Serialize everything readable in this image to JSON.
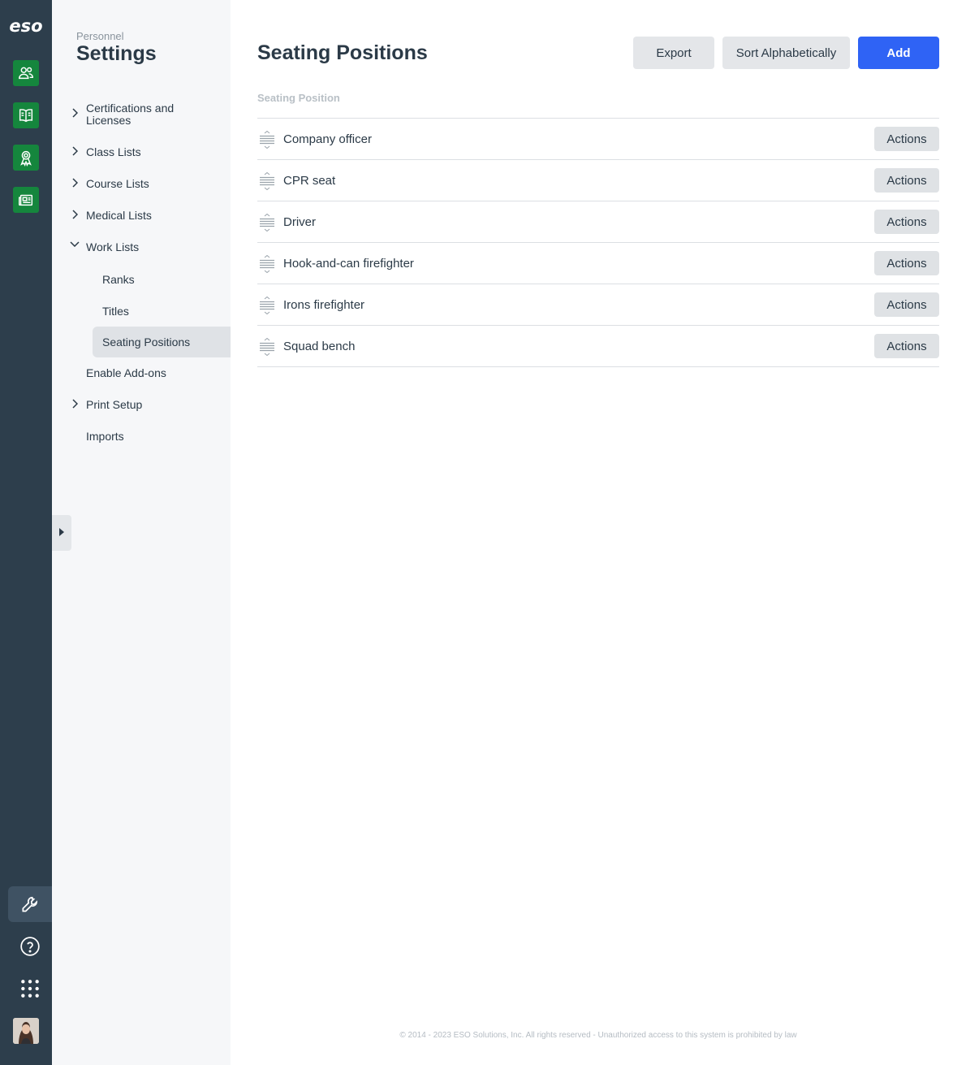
{
  "rail": {
    "logo": "eso",
    "apps": [
      {
        "icon": "people-icon"
      },
      {
        "icon": "book-icon"
      },
      {
        "icon": "award-ribbon-icon"
      },
      {
        "icon": "news-id-icon"
      }
    ],
    "bottom": [
      {
        "icon": "wrench-icon",
        "active": true
      },
      {
        "icon": "help-circle-icon"
      },
      {
        "icon": "app-grid-icon"
      }
    ],
    "accent_color": "#15863d",
    "rail_color": "#2d3e4c"
  },
  "nav": {
    "eyebrow": "Personnel",
    "title": "Settings",
    "items": [
      {
        "label_line1": "Certifications and",
        "label_line2": "Licenses",
        "chevron": "right"
      },
      {
        "label": "Class Lists",
        "chevron": "right"
      },
      {
        "label": "Course Lists",
        "chevron": "right"
      },
      {
        "label": "Medical Lists",
        "chevron": "right"
      },
      {
        "label": "Work Lists",
        "chevron": "down"
      },
      {
        "label": "Enable Add-ons"
      },
      {
        "label": "Print Setup",
        "chevron": "right"
      },
      {
        "label": "Imports"
      }
    ],
    "work_lists_children": [
      {
        "label": "Ranks"
      },
      {
        "label": "Titles"
      },
      {
        "label": "Seating Positions",
        "active": true
      }
    ]
  },
  "main": {
    "title": "Seating Positions",
    "buttons": {
      "export": "Export",
      "sort": "Sort Alphabetically",
      "add": "Add"
    },
    "column_header": "Seating Position",
    "rows": [
      {
        "label": "Company officer",
        "action": "Actions"
      },
      {
        "label": "CPR seat",
        "action": "Actions"
      },
      {
        "label": "Driver",
        "action": "Actions"
      },
      {
        "label": "Hook-and-can firefighter",
        "action": "Actions"
      },
      {
        "label": "Irons firefighter",
        "action": "Actions"
      },
      {
        "label": "Squad bench",
        "action": "Actions"
      }
    ],
    "primary_color": "#2f63f5"
  },
  "footer": {
    "text": "© 2014 - 2023 ESO Solutions, Inc. All rights reserved - Unauthorized access to this system is prohibited by law"
  }
}
